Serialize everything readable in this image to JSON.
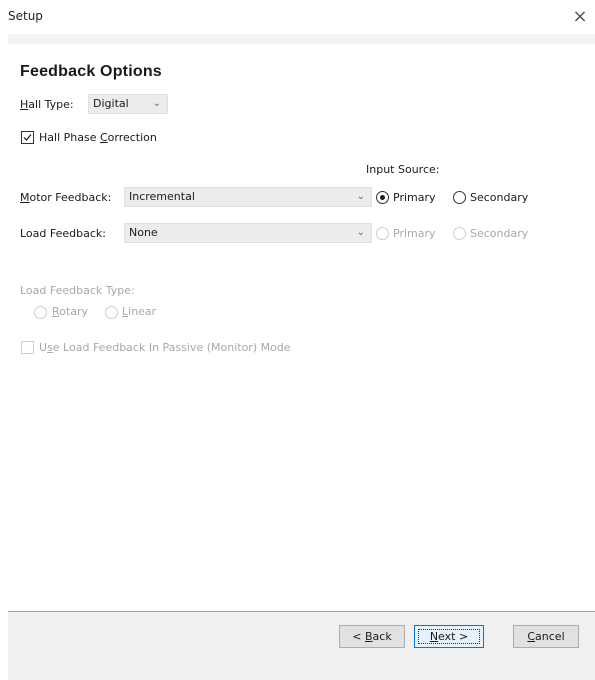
{
  "window": {
    "title": "Setup",
    "close_glyph": "×"
  },
  "page": {
    "heading": "Feedback Options"
  },
  "hall_type": {
    "label_accel": "H",
    "label_rest": "all Type:",
    "selected": "Digital"
  },
  "hall_phase_correction": {
    "label_pre": "Hall Phase ",
    "label_accel": "C",
    "label_post": "orrection",
    "checked": true
  },
  "input_source": {
    "header": "Input Source:"
  },
  "motor_feedback": {
    "label_accel": "M",
    "label_rest": "otor Feedback:",
    "selected": "Incremental",
    "source_primary": "Primary",
    "source_secondary": "Secondary",
    "selected_source": "Primary"
  },
  "load_feedback": {
    "label": "Load Feedback:",
    "selected": "None",
    "source_primary": "Primary",
    "source_secondary": "Secondary"
  },
  "load_feedback_type": {
    "label": "Load Feedback Type:",
    "rotary_accel": "R",
    "rotary_rest": "otary",
    "linear_accel": "L",
    "linear_rest": "inear"
  },
  "passive_mode": {
    "label_pre": "U",
    "label_accel": "s",
    "label_post": "e Load Feedback In Passive (Monitor) Mode",
    "checked": false
  },
  "buttons": {
    "back_pre": "< ",
    "back_accel": "B",
    "back_rest": "ack",
    "next_accel": "N",
    "next_rest": "ext >",
    "cancel_accel": "C",
    "cancel_rest": "ancel"
  },
  "icons": {
    "close": "close-icon",
    "chevron": "chevron-down-icon",
    "check": "check-icon"
  },
  "colors": {
    "default_button_border": "#0078d7",
    "disabled_text": "#a8a8a8",
    "combo_bg": "#ececec"
  }
}
